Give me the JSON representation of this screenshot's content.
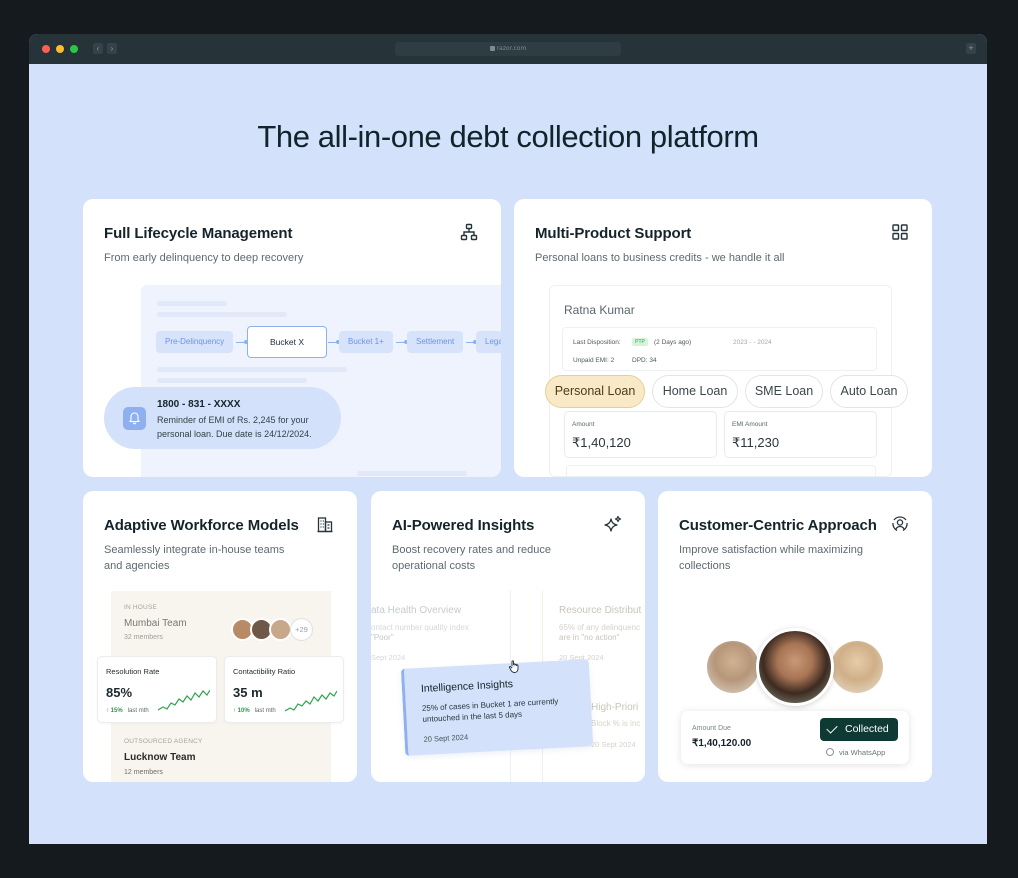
{
  "browser": {
    "url": "razor.com",
    "plus_label": "+",
    "back_label": "‹",
    "forward_label": "›"
  },
  "page": {
    "title": "The all-in-one debt collection platform"
  },
  "lifecycle": {
    "title": "Full Lifecycle Management",
    "subtitle": "From early delinquency to deep recovery",
    "stages": [
      "Pre-Delinquency",
      "Bucket X",
      "Bucket 1+",
      "Settlement",
      "Legal"
    ],
    "notification": {
      "number": "1800 - 831 - XXXX",
      "message": "Reminder of EMI of Rs. 2,245 for your personal loan. Due date is 24/12/2024."
    },
    "icon": "hierarchy-icon"
  },
  "multiproduct": {
    "title": "Multi-Product Support",
    "subtitle": "Personal loans to business credits - we handle it all",
    "customer_name": "Ratna Kumar",
    "last_disposition_label": "Last Disposition:",
    "last_disposition_badge": "PTP",
    "last_disposition_detail": "(2 Days ago)",
    "last_disposition_date": "2023 - - 2024",
    "unpaid_emi": "Unpaid EMI: 2",
    "dpd": "DPD: 34",
    "chips": [
      "Personal Loan",
      "Home Loan",
      "SME Loan",
      "Auto Loan"
    ],
    "selected_chip": "Personal Loan",
    "amount_label": "Amount",
    "amount_value": "₹1,40,120",
    "emi_label": "EMI Amount",
    "emi_value": "₹11,230",
    "icon": "grid-icon"
  },
  "workforce": {
    "title": "Adaptive Workforce Models",
    "subtitle_line1": "Seamlessly integrate in-house teams",
    "subtitle_line2": "and agencies",
    "inhouse_tag": "IN HOUSE",
    "inhouse_team": "Mumbai Team",
    "inhouse_members": "32 members",
    "avatar_more": "+29",
    "resolution": {
      "label": "Resolution Rate",
      "value": "85%",
      "delta": "↑ 15%",
      "period": "last mth"
    },
    "contactibility": {
      "label": "Contactibility Ratio",
      "value": "35 m",
      "delta": "↑ 10%",
      "period": "last mth"
    },
    "agency_tag": "OUTSOURCED AGENCY",
    "agency_team": "Lucknow Team",
    "agency_members": "12 members",
    "icon": "building-icon"
  },
  "insights": {
    "title": "AI-Powered Insights",
    "subtitle_line1": "Boost recovery rates and reduce",
    "subtitle_line2": "operational costs",
    "bg_left_title": "ata Health Overview",
    "bg_left_line1": "ontact number quality index",
    "bg_left_line2": "\"Poor\"",
    "bg_left_date": "Sept 2024",
    "bg_right_title": "Resource Distribut",
    "bg_right_line1": "65% of any delinquenc",
    "bg_right_line2": "are in \"no action\"",
    "bg_right_date": "20 Sept 2024",
    "bg_right2_title": "High-Priori",
    "bg_right2_line1": "Block % is inc",
    "bg_right2_date": "20 Sept 2024",
    "card_title": "Intelligence Insights",
    "card_body": "25% of cases in Bucket 1 are currently untouched in the last 5 days",
    "card_date": "20 Sept 2024",
    "icon": "sparkle-icon"
  },
  "customer": {
    "title": "Customer-Centric Approach",
    "subtitle_line1": "Improve satisfaction while maximizing",
    "subtitle_line2": "collections",
    "amount_label": "Amount Due",
    "amount_value": "₹1,40,120.00",
    "status": "Collected",
    "channel": "via WhatsApp",
    "icon": "user-circle-icon"
  }
}
